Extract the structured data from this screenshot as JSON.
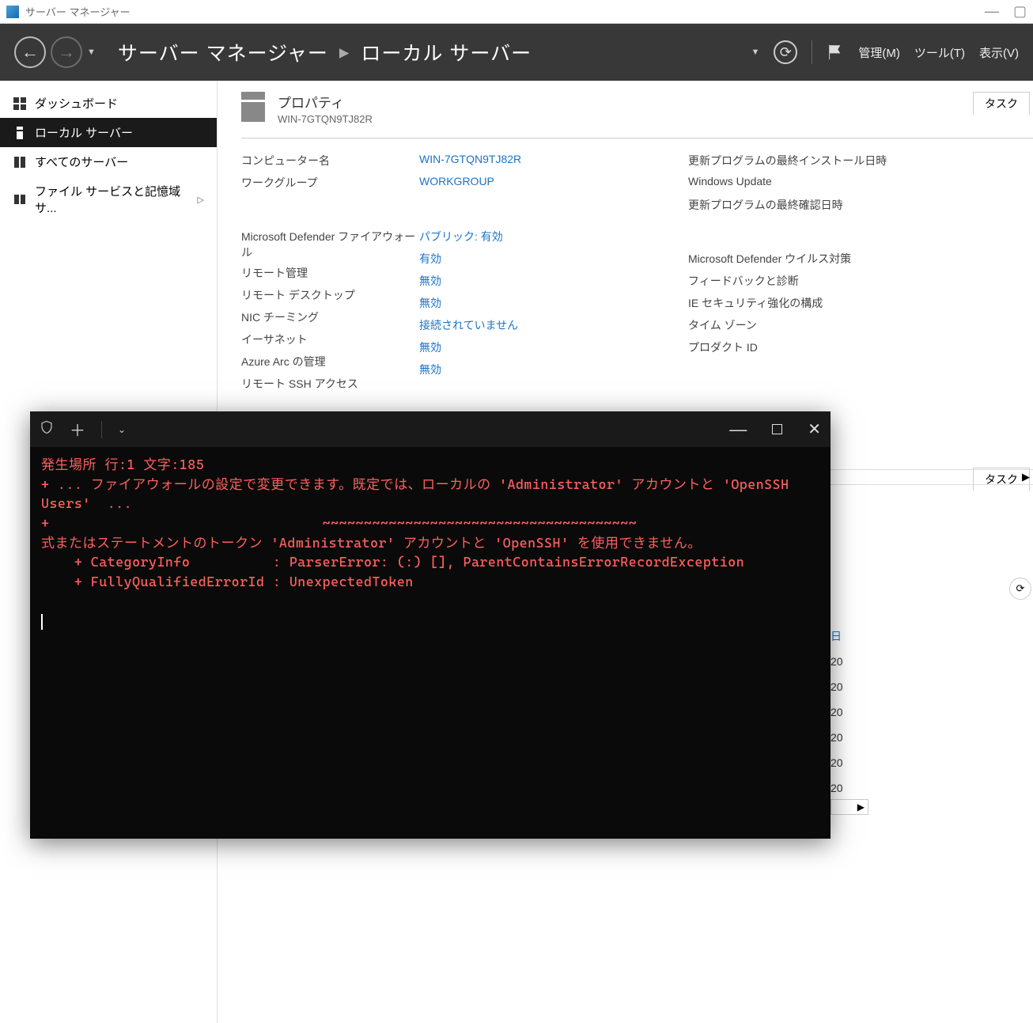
{
  "titlebar": {
    "text": "サーバー マネージャー"
  },
  "header": {
    "breadcrumb": {
      "root": "サーバー マネージャー",
      "leaf": "ローカル サーバー"
    },
    "menu": {
      "manage": "管理(M)",
      "tools": "ツール(T)",
      "view": "表示(V)"
    }
  },
  "sidebar": {
    "items": [
      {
        "label": "ダッシュボード",
        "icon": "dashboard"
      },
      {
        "label": "ローカル サーバー",
        "icon": "server",
        "active": true
      },
      {
        "label": "すべてのサーバー",
        "icon": "servers"
      },
      {
        "label": "ファイル サービスと記憶域サ...",
        "icon": "files",
        "caret": true
      }
    ]
  },
  "properties": {
    "title": "プロパティ",
    "subtitle": "WIN-7GTQN9TJ82R",
    "task_label": "タスク",
    "left_rows": [
      {
        "label": "コンピューター名",
        "value": "WIN-7GTQN9TJ82R"
      },
      {
        "label": "ワークグループ",
        "value": "WORKGROUP"
      }
    ],
    "left_rows2": [
      {
        "label": "Microsoft Defender ファイアウォール",
        "value": "パブリック: 有効"
      },
      {
        "label": "リモート管理",
        "value": "有効"
      },
      {
        "label": "リモート デスクトップ",
        "value": "無効"
      },
      {
        "label": "NIC チーミング",
        "value": "無効"
      },
      {
        "label": "イーサネット",
        "value": "接続されていません"
      },
      {
        "label": "Azure Arc の管理",
        "value": "無効"
      },
      {
        "label": "リモート SSH アクセス",
        "value": "無効"
      }
    ],
    "right_rows": [
      {
        "label": "更新プログラムの最終インストール日時"
      },
      {
        "label": "Windows Update"
      },
      {
        "label": "更新プログラムの最終確認日時"
      }
    ],
    "right_rows2": [
      {
        "label": "Microsoft Defender ウイルス対策"
      },
      {
        "label": "フィードバックと診断"
      },
      {
        "label": "IE セキュリティ強化の構成"
      },
      {
        "label": "タイム ゾーン"
      },
      {
        "label": "プロダクト ID"
      }
    ],
    "task_label2": "タスク"
  },
  "peek": {
    "header": "日",
    "values": [
      "20",
      "20",
      "20",
      "20",
      "20",
      "20"
    ]
  },
  "terminal": {
    "lines": [
      "発生場所 行:1 文字:185",
      "+ ... ファイアウォールの設定で変更できます。既定では、ローカルの 'Administrator' アカウントと 'OpenSSH Users'  ...",
      "+                                 ~~~~~~~~~~~~~~~~~~~~~~~~~~~~~~~~~~~~~~",
      "式またはステートメントのトークン 'Administrator' アカウントと 'OpenSSH' を使用できません。",
      "    + CategoryInfo          : ParserError: (:) [], ParentContainsErrorRecordException",
      "    + FullyQualifiedErrorId : UnexpectedToken",
      ""
    ]
  }
}
